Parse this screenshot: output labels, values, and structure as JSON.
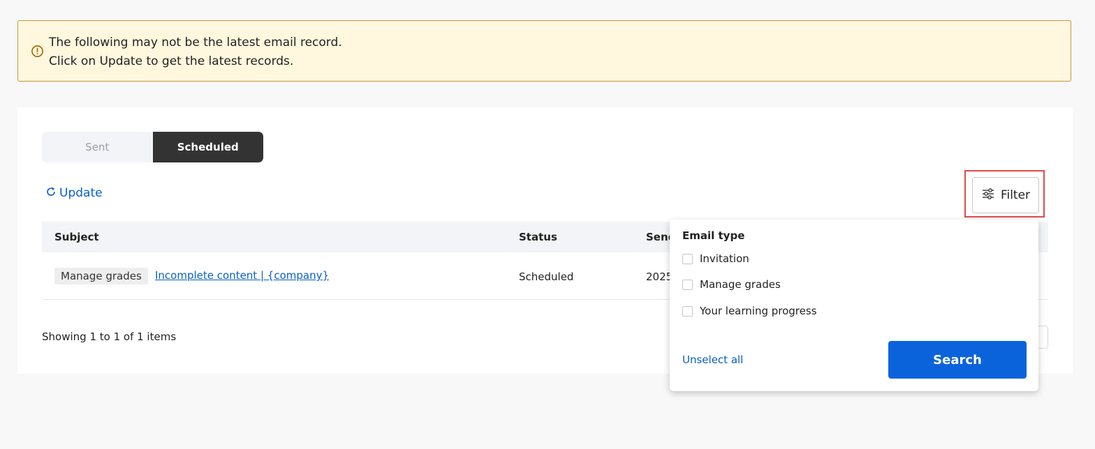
{
  "alert": {
    "line1": "The following may not be the latest email record.",
    "line2": "Click on Update to get the latest records."
  },
  "tabs": [
    {
      "label": "Sent",
      "selected": false
    },
    {
      "label": "Scheduled",
      "selected": true
    }
  ],
  "update_label": "Update",
  "filter_label": "Filter",
  "table": {
    "columns": [
      "Subject",
      "Status",
      "Send"
    ],
    "rows": [
      {
        "tag": "Manage grades",
        "subject": "Incomplete content | {company}",
        "status": "Scheduled",
        "date": "2025"
      }
    ]
  },
  "showing": "Showing 1 to 1 of 1 items",
  "filter_panel": {
    "title": "Email type",
    "options": [
      "Invitation",
      "Manage grades",
      "Your learning progress"
    ],
    "unselect_label": "Unselect all",
    "search_label": "Search"
  },
  "colors": {
    "accent": "#0b63dc",
    "link": "#0a5fc2",
    "alert_bg": "#fff7de",
    "alert_border": "#c8963c",
    "highlight": "#e04a4a"
  }
}
